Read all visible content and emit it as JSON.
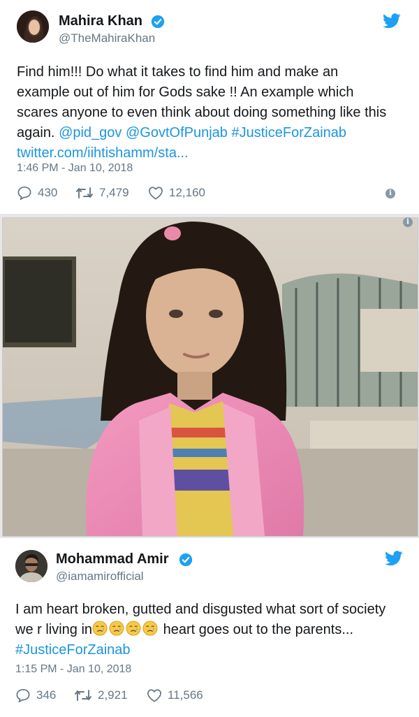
{
  "tweet1": {
    "name": "Mahira Khan",
    "handle": "@TheMahiraKhan",
    "lines": [
      "Find him!!! Do what it takes to find him and make an",
      "example out of him for Gods sake !! An example which",
      "scares anyone to even think about doing something like this"
    ],
    "line4_prefix": "again.",
    "mentions": [
      "@pid_gov",
      "@GovtOfPunjab"
    ],
    "hashtag": "#JusticeForZainab",
    "url": "twitter.com/iihtishamm/sta...",
    "timestamp": "1:46 PM - Jan 10, 2018",
    "replies": "430",
    "retweets": "7,479",
    "likes": "12,160"
  },
  "tweet2": {
    "name": "Mohammad Amir",
    "handle": "@iamamirofficial",
    "line1": "I am heart broken, gutted and disgusted what sort of society",
    "line2_prefix": "we r living in",
    "line2_suffix": "heart goes out to the parents...",
    "hashtag": "#JusticeForZainab",
    "timestamp": "1:15 PM - Jan 10, 2018",
    "replies": "346",
    "retweets": "2,921",
    "likes": "11,566"
  },
  "icons": {
    "verified": "verified-badge-icon",
    "bird": "twitter-bird-icon",
    "reply": "reply-icon",
    "retweet": "retweet-icon",
    "like": "heart-icon",
    "info": "info-icon",
    "emoji": "crying-face-emoji"
  },
  "colors": {
    "link": "#1b95e0",
    "verified": "#1da1f2",
    "meta": "#657786"
  }
}
